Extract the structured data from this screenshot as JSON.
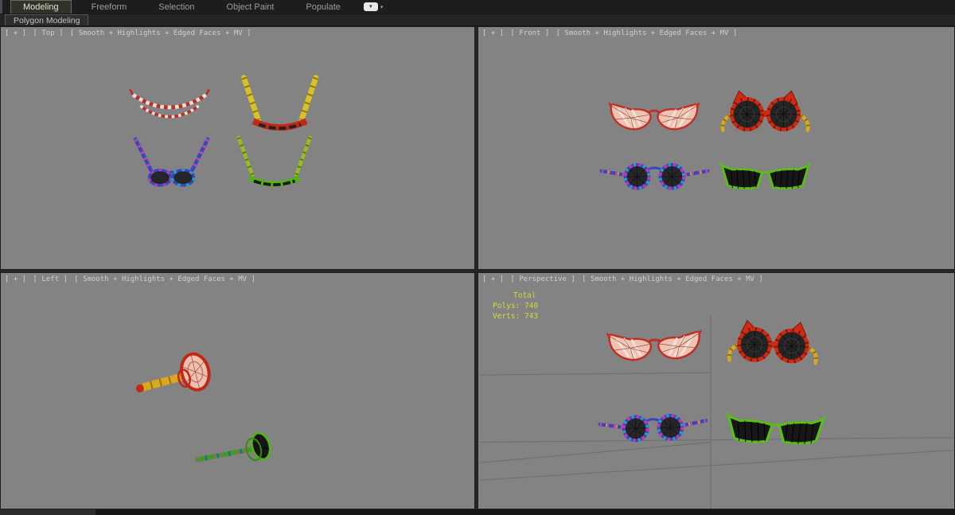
{
  "ribbon": {
    "tabs": [
      {
        "label": "Modeling",
        "active": true
      },
      {
        "label": "Freeform",
        "active": false
      },
      {
        "label": "Selection",
        "active": false
      },
      {
        "label": "Object Paint",
        "active": false
      },
      {
        "label": "Populate",
        "active": false
      }
    ],
    "minimize_arrow": "▾",
    "panel_tab": "Polygon Modeling"
  },
  "viewports": {
    "top": {
      "plus": "[ + ]",
      "name": "[ Top ]",
      "shading": "[ Smooth + Highlights + Edged Faces + MV ]"
    },
    "front": {
      "plus": "[ + ]",
      "name": "[ Front ]",
      "shading": "[ Smooth + Highlights + Edged Faces + MV ]"
    },
    "left": {
      "plus": "[ + ]",
      "name": "[ Left ]",
      "shading": "[ Smooth + Highlights + Edged Faces + MV ]"
    },
    "perspective": {
      "plus": "[ + ]",
      "name": "[ Perspective ]",
      "shading": "[ Smooth + Highlights + Edged Faces + MV ]"
    }
  },
  "stats": {
    "title": "Total",
    "polys": "Polys: 740",
    "verts": "Verts: 743"
  },
  "scene_objects": [
    "pink-cat-eye-glasses",
    "red-goggles-yellow-straps",
    "round-rainbow-blue-glasses",
    "green-cat-eye-glasses"
  ],
  "colors": {
    "viewport_bg": "#838383",
    "ui_bg": "#1d1d1d",
    "stats_yellow": "#d6d63a",
    "frame_red": "#c02818",
    "frame_green": "#50b414",
    "frame_blue": "#3846c0",
    "temple_yellow": "#d8a820",
    "lens_pink": "#efc3b2"
  }
}
